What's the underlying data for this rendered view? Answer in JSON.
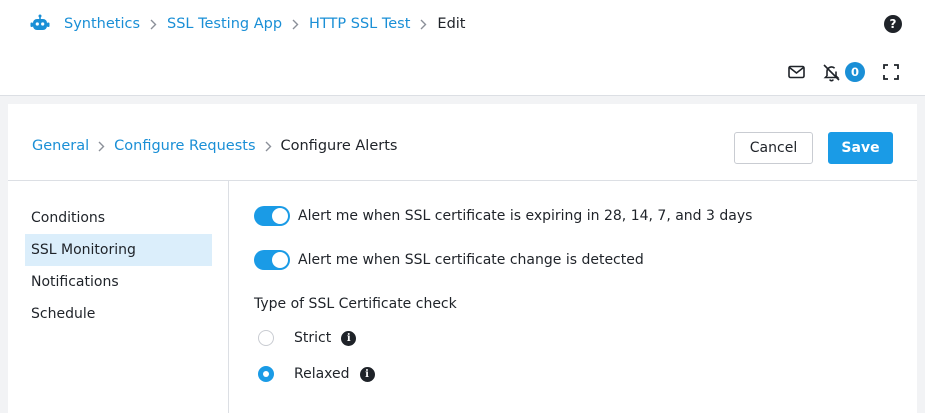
{
  "breadcrumb": {
    "items": [
      "Synthetics",
      "SSL Testing App",
      "HTTP SSL Test"
    ],
    "current": "Edit"
  },
  "header": {
    "help": "?",
    "notification_count": "0"
  },
  "steps": {
    "items": [
      "General",
      "Configure Requests"
    ],
    "current": "Configure Alerts"
  },
  "actions": {
    "cancel": "Cancel",
    "save": "Save"
  },
  "sidebar": {
    "items": [
      {
        "label": "Conditions"
      },
      {
        "label": "SSL Monitoring"
      },
      {
        "label": "Notifications"
      },
      {
        "label": "Schedule"
      }
    ],
    "active": "SSL Monitoring"
  },
  "ssl": {
    "expiry_alert": {
      "label": "Alert me when SSL certificate is expiring in 28, 14, 7, and 3 days",
      "enabled": true
    },
    "change_alert": {
      "label": "Alert me when SSL certificate change is detected",
      "enabled": true
    },
    "check_type_title": "Type of SSL Certificate check",
    "check_options": [
      {
        "label": "Strict",
        "selected": false
      },
      {
        "label": "Relaxed",
        "selected": true
      }
    ]
  },
  "colors": {
    "accent": "#1a9be6",
    "link": "#1a8fd6",
    "active_bg": "#dbeefb"
  }
}
